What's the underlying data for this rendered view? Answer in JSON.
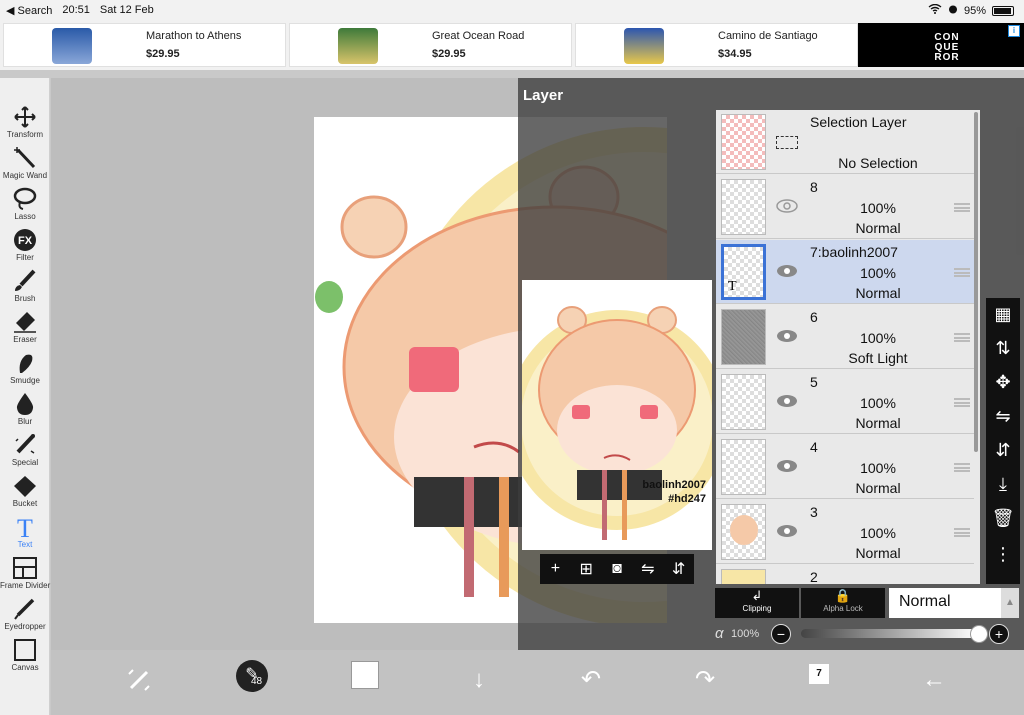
{
  "status_bar": {
    "back_label": "◀ Search",
    "time": "20:51",
    "date": "Sat 12 Feb",
    "battery": "95%"
  },
  "ads": [
    {
      "title": "Marathon to Athens",
      "price": "$29.95"
    },
    {
      "title": "Great Ocean Road",
      "price": "$29.95"
    },
    {
      "title": "Camino de Santiago",
      "price": "$34.95"
    }
  ],
  "ad_brand": "CON\nQUE\nROR",
  "tools": [
    {
      "label": "Transform",
      "icon": "move-arrows-icon"
    },
    {
      "label": "Magic Wand",
      "icon": "magic-wand-icon"
    },
    {
      "label": "Lasso",
      "icon": "lasso-icon"
    },
    {
      "label": "Filter",
      "icon": "fx-icon"
    },
    {
      "label": "Brush",
      "icon": "brush-icon"
    },
    {
      "label": "Eraser",
      "icon": "eraser-icon"
    },
    {
      "label": "Smudge",
      "icon": "smudge-icon"
    },
    {
      "label": "Blur",
      "icon": "drop-icon"
    },
    {
      "label": "Special",
      "icon": "special-brush-icon"
    },
    {
      "label": "Bucket",
      "icon": "bucket-icon"
    },
    {
      "label": "Text",
      "icon": "text-icon",
      "active": true
    },
    {
      "label": "Frame Divider",
      "icon": "frame-divider-icon"
    },
    {
      "label": "Eyedropper",
      "icon": "eyedropper-icon"
    },
    {
      "label": "Canvas",
      "icon": "canvas-icon"
    }
  ],
  "layer_panel": {
    "title": "Layer",
    "preview_text": [
      "baolinh2007",
      "#hd247"
    ],
    "layers": [
      {
        "name": "Selection Layer",
        "opacity": "",
        "mode": "No Selection",
        "kind": "selection"
      },
      {
        "name": "8",
        "opacity": "100%",
        "mode": "Normal",
        "kind": "empty",
        "visible": false
      },
      {
        "name": "7:baolinh2007",
        "opacity": "100%",
        "mode": "Normal",
        "kind": "text",
        "selected": true
      },
      {
        "name": "6",
        "opacity": "100%",
        "mode": "Soft Light",
        "kind": "noise"
      },
      {
        "name": "5",
        "opacity": "100%",
        "mode": "Normal",
        "kind": "sketch"
      },
      {
        "name": "4",
        "opacity": "100%",
        "mode": "Normal",
        "kind": "sketch"
      },
      {
        "name": "3",
        "opacity": "100%",
        "mode": "Normal",
        "kind": "color"
      },
      {
        "name": "2",
        "opacity": "",
        "mode": "",
        "kind": "circle"
      }
    ],
    "clipping_label": "Clipping",
    "alpha_lock_label": "Alpha Lock",
    "blend_mode": "Normal",
    "alpha_symbol": "α",
    "opacity_value": "100%",
    "opacity_fraction": 1.0
  },
  "bottom_bar": {
    "brush_size": "48",
    "layer_count": "7",
    "color": "#ffffff"
  },
  "colors": {
    "accent": "#3b82f6",
    "selected_row": "#cdd8ee",
    "panel": "#3c3c3c"
  }
}
